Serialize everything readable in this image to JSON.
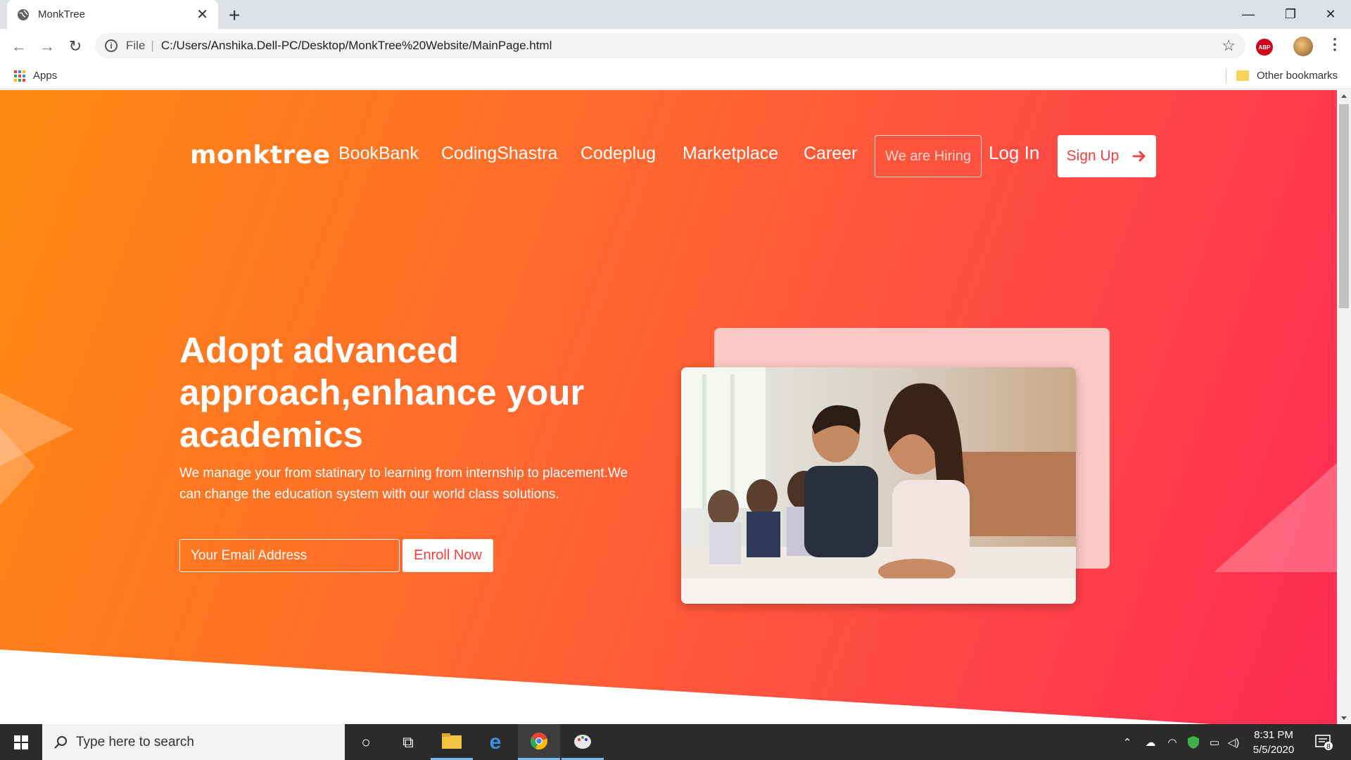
{
  "browser": {
    "tab_title": "MonkTree",
    "address_prefix": "File",
    "url": "C:/Users/Anshika.Dell-PC/Desktop/MonkTree%20Website/MainPage.html",
    "bookmarks_apps": "Apps",
    "bookmarks_other": "Other bookmarks",
    "abp_label": "ABP"
  },
  "site": {
    "logo": "monktree",
    "nav": [
      "BookBank",
      "CodingShastra",
      "Codeplug",
      "Marketplace",
      "Career"
    ],
    "hiring_label": "We are Hiring",
    "login_label": "Log In",
    "signup_label": "Sign Up",
    "headline": "Adopt advanced approach,enhance your academics",
    "subtext": "We manage your from statinary to learning from internship to placement.We can change the education system with our world class solutions.",
    "email_placeholder": "Your Email Address",
    "enroll_label": "Enroll Now",
    "colors": {
      "gradient_start": "#ff8a12",
      "gradient_end": "#ff2a55",
      "accent_text": "#ff3b3b"
    }
  },
  "taskbar": {
    "search_placeholder": "Type here to search",
    "time": "8:31 PM",
    "date": "5/5/2020",
    "notification_count": "8"
  }
}
